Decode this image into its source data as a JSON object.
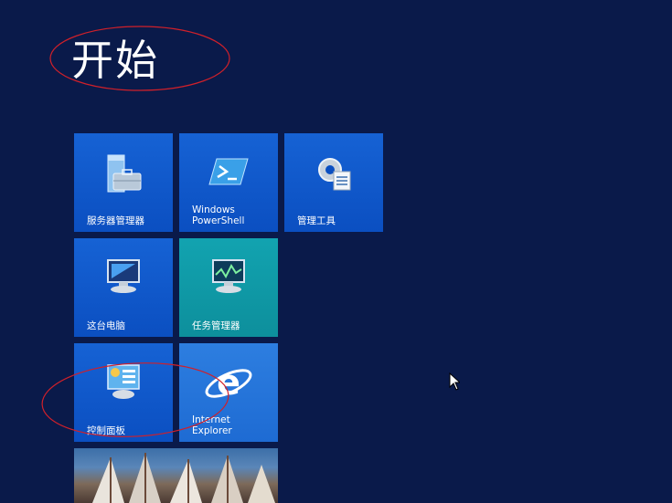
{
  "page": {
    "title": "开始"
  },
  "tiles": [
    {
      "id": "server-manager",
      "label": "服务器管理器",
      "icon": "server-manager-icon"
    },
    {
      "id": "powershell",
      "label": "Windows\nPowerShell",
      "icon": "powershell-icon"
    },
    {
      "id": "admin-tools",
      "label": "管理工具",
      "icon": "admin-tools-icon"
    },
    {
      "id": "this-pc",
      "label": "这台电脑",
      "icon": "computer-icon"
    },
    {
      "id": "task-manager",
      "label": "任务管理器",
      "icon": "task-manager-icon"
    },
    {
      "id": "control-panel",
      "label": "控制面板",
      "icon": "control-panel-icon"
    },
    {
      "id": "internet-explorer",
      "label": "Internet\nExplorer",
      "icon": "internet-explorer-icon"
    },
    {
      "id": "desktop",
      "label": "",
      "icon": "desktop-photo"
    }
  ],
  "colors": {
    "background": "#0a1a4a",
    "tile_blue": "#0b4fc1",
    "tile_teal": "#0d8f9c",
    "tile_ie": "#1e6bd3",
    "annotation": "#d0202a"
  }
}
